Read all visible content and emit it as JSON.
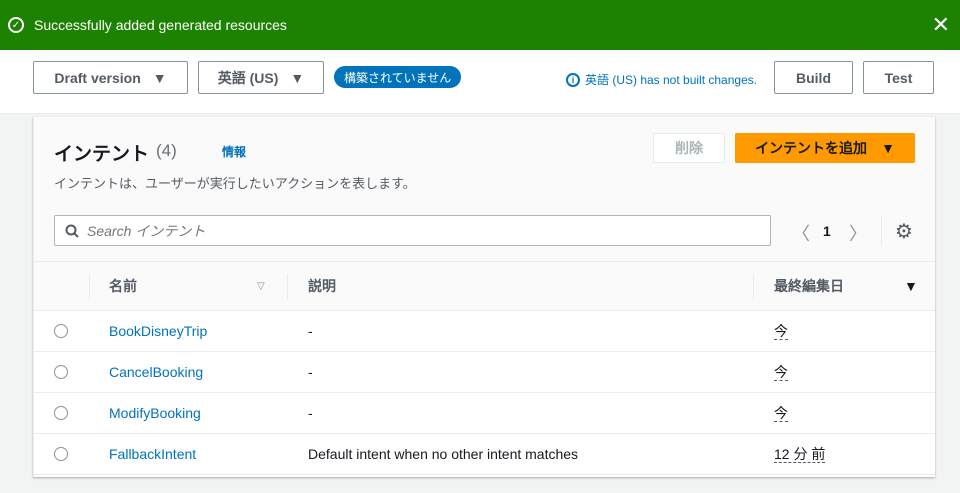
{
  "banner": {
    "message": "Successfully added generated resources"
  },
  "topbar": {
    "version": "Draft version",
    "language": "英語 (US)",
    "status_badge": "構築されていません",
    "info_text": "英語 (US) has not built changes.",
    "build": "Build",
    "test": "Test"
  },
  "panel": {
    "title": "インテント",
    "count": "(4)",
    "info": "情報",
    "description": "インテントは、ユーザーが実行したいアクションを表します。",
    "delete": "削除",
    "add": "インテントを追加",
    "search_placeholder": "Search インテント",
    "page": "1"
  },
  "table": {
    "headers": {
      "name": "名前",
      "description": "説明",
      "modified": "最終編集日"
    },
    "rows": [
      {
        "name": "BookDisneyTrip",
        "description": "-",
        "modified": "今"
      },
      {
        "name": "CancelBooking",
        "description": "-",
        "modified": "今"
      },
      {
        "name": "ModifyBooking",
        "description": "-",
        "modified": "今"
      },
      {
        "name": "FallbackIntent",
        "description": "Default intent when no other intent matches",
        "modified": "12 分 前"
      }
    ]
  },
  "colors": {
    "success": "#1d8102",
    "primary": "#ff9900",
    "link": "#0073bb"
  }
}
